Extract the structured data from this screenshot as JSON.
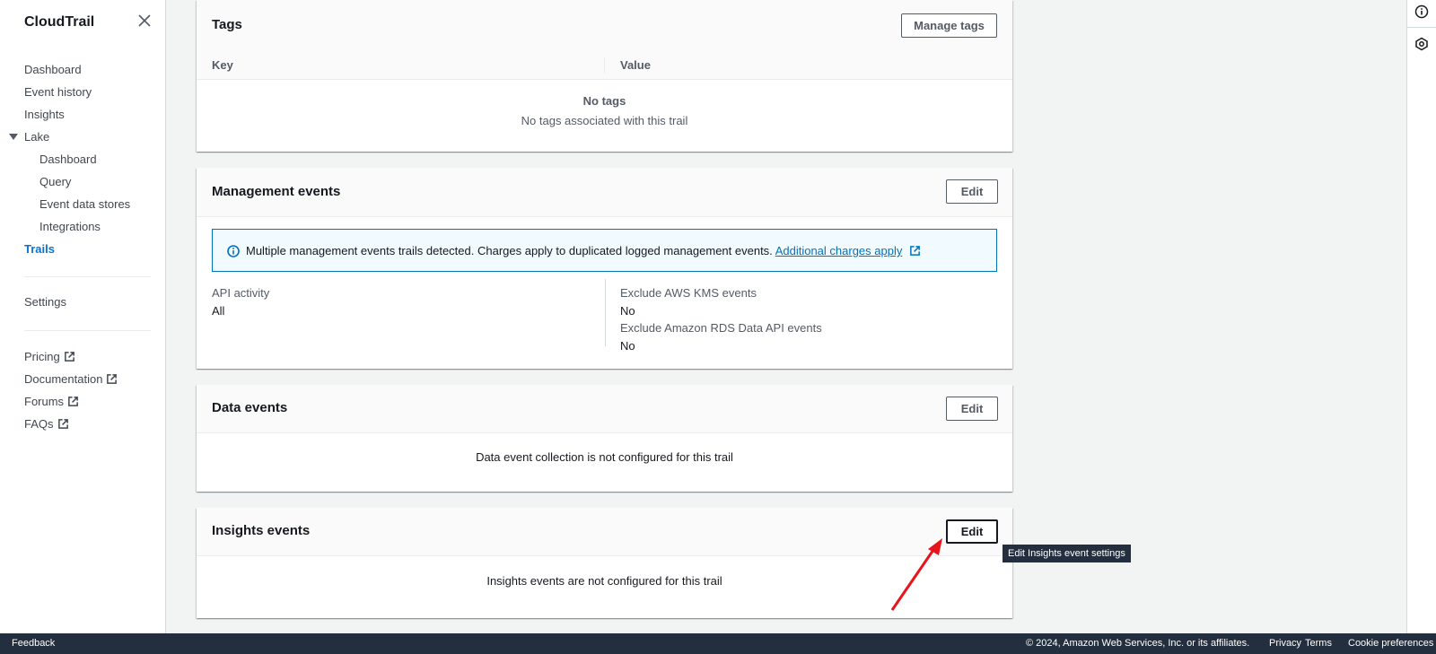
{
  "sidebar": {
    "title": "CloudTrail",
    "items": [
      {
        "label": "Dashboard"
      },
      {
        "label": "Event history"
      },
      {
        "label": "Insights"
      },
      {
        "label": "Lake"
      },
      {
        "label": "Dashboard"
      },
      {
        "label": "Query"
      },
      {
        "label": "Event data stores"
      },
      {
        "label": "Integrations"
      },
      {
        "label": "Trails"
      },
      {
        "label": "Settings"
      },
      {
        "label": "Pricing"
      },
      {
        "label": "Documentation"
      },
      {
        "label": "Forums"
      },
      {
        "label": "FAQs"
      }
    ]
  },
  "tags": {
    "title": "Tags",
    "button": "Manage tags",
    "col_key": "Key",
    "col_value": "Value",
    "empty_title": "No tags",
    "empty_desc": "No tags associated with this trail"
  },
  "management": {
    "title": "Management events",
    "button": "Edit",
    "alert_text": "Multiple management events trails detected. Charges apply to duplicated logged management events.",
    "alert_link": "Additional charges apply",
    "api_label": "API activity",
    "api_value": "All",
    "kms_label": "Exclude AWS KMS events",
    "kms_value": "No",
    "rds_label": "Exclude Amazon RDS Data API events",
    "rds_value": "No"
  },
  "data_events": {
    "title": "Data events",
    "button": "Edit",
    "message": "Data event collection is not configured for this trail"
  },
  "insights": {
    "title": "Insights events",
    "button": "Edit",
    "message": "Insights events are not configured for this trail",
    "tooltip": "Edit Insights event settings"
  },
  "footer": {
    "feedback": "Feedback",
    "copyright": "© 2024, Amazon Web Services, Inc. or its affiliates.",
    "privacy": "Privacy",
    "terms": "Terms",
    "cookies": "Cookie preferences"
  },
  "icons": {
    "close": "close-icon",
    "info": "info-icon",
    "external": "external-link-icon",
    "rail_info": "info-icon",
    "rail_settings": "settings-hex-icon"
  },
  "colors": {
    "accent": "#0972d3",
    "alert_bg": "#f1faff",
    "alert_border": "#0073bb",
    "footer_bg": "#232f3e",
    "annotation_arrow": "#e8141b"
  }
}
